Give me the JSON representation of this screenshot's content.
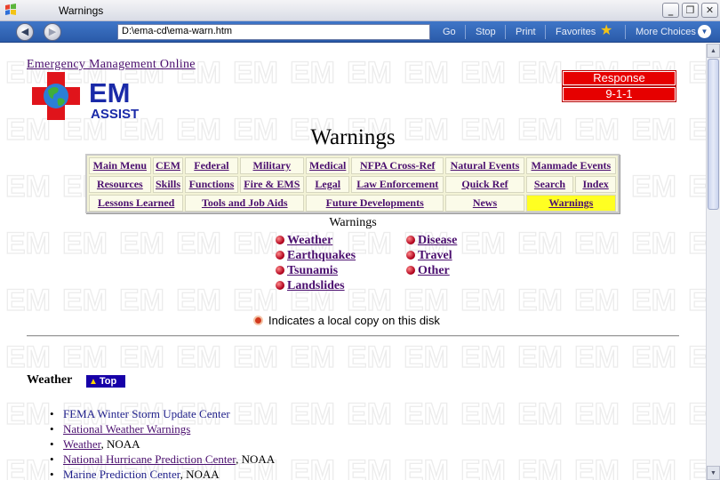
{
  "window": {
    "title": "Warnings"
  },
  "toolbar": {
    "address": "D:\\ema-cd\\ema-warn.htm",
    "go": "Go",
    "stop": "Stop",
    "print": "Print",
    "favorites": "Favorites",
    "more": "More Choices"
  },
  "site": {
    "title": "Emergency Management Online",
    "logo_text": "EM",
    "logo_sub": "ASSIST"
  },
  "response": {
    "label": "Response",
    "number": "9-1-1"
  },
  "page": {
    "heading": "Warnings",
    "sub_heading": "Warnings"
  },
  "menu": {
    "row1": [
      "Main Menu",
      "CEM",
      "Federal",
      "Military",
      "Medical",
      "NFPA Cross-Ref",
      "Natural Events",
      "Manmade Events"
    ],
    "row2": [
      "Resources",
      "Skills",
      "Functions",
      "Fire & EMS",
      "Legal",
      "Law Enforcement",
      "Quick Ref",
      "Search",
      "Index"
    ],
    "row3": [
      "Lessons Learned",
      "Tools and Job Aids",
      "Future Developments",
      "News",
      "Warnings"
    ]
  },
  "toc": {
    "left": [
      "Weather",
      "Earthquakes",
      "Tsunamis",
      "Landslides"
    ],
    "right": [
      "Disease",
      "Travel",
      "Other"
    ]
  },
  "local_note": "Indicates a local copy on this disk",
  "section": {
    "title": "Weather",
    "top_label": "Top"
  },
  "weather_links": [
    {
      "link": "FEMA Winter Storm Update Center",
      "suffix": ""
    },
    {
      "link": "National Weather Warnings",
      "suffix": ""
    },
    {
      "link": "Weather",
      "suffix": ", NOAA"
    },
    {
      "link": "National Hurricane Prediction Center",
      "suffix": ", NOAA"
    },
    {
      "link": "Marine Prediction Center",
      "suffix": ", NOAA"
    }
  ],
  "colors": {
    "link": "#4b0f6f",
    "response": "#e60000",
    "menu_active": "#ffff22",
    "toolbar": "#2a5aa8"
  }
}
